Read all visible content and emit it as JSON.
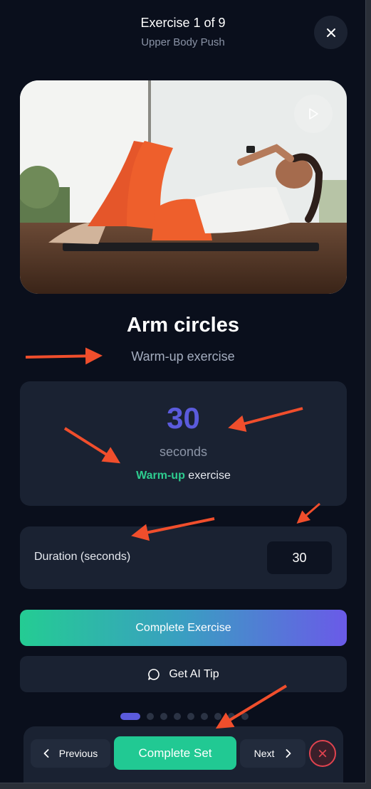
{
  "header": {
    "title": "Exercise 1 of 9",
    "subtitle": "Upper Body Push"
  },
  "exercise": {
    "name": "Arm circles",
    "type": "Warm-up exercise"
  },
  "stat": {
    "value": "30",
    "unit": "seconds",
    "note_accent": "Warm-up",
    "note_rest": " exercise"
  },
  "duration": {
    "label": "Duration (seconds)",
    "value": "30"
  },
  "actions": {
    "complete_exercise": "Complete Exercise",
    "ai_tip": "Get AI Tip"
  },
  "progress": {
    "total": 9,
    "current": 1
  },
  "footer": {
    "previous": "Previous",
    "complete_set": "Complete Set",
    "next": "Next"
  },
  "colors": {
    "background": "#0a0f1c",
    "card": "#1a2232",
    "accent_primary": "#5b5bdc",
    "accent_green": "#21c993",
    "danger": "#e0434f",
    "annotation_arrow": "#f04e2c"
  },
  "icons": {
    "close": "close-icon",
    "play": "play-icon",
    "chat": "chat-bubble-icon",
    "chevron_left": "chevron-left-icon",
    "chevron_right": "chevron-right-icon",
    "exit": "close-circle-icon"
  }
}
